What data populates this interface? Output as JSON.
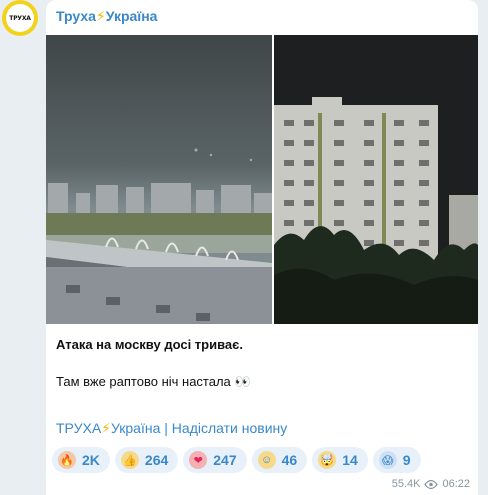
{
  "channel": {
    "avatar_label": "ТРУХА",
    "name": "Труха",
    "name_suffix": "Україна"
  },
  "post": {
    "headline": "Атака на москву досі триває.",
    "body": "Там вже раптово ніч настала",
    "body_emoji": "👀"
  },
  "footer_links": {
    "channel_part1": "ТРУХА",
    "channel_part2": "Україна",
    "separator": "|",
    "submit": "Надіслати новину"
  },
  "reactions": [
    {
      "emoji": "🔥",
      "emoji_icon": "fire-icon",
      "count": "2K",
      "bg": "#f4c7a5"
    },
    {
      "emoji": "👍",
      "emoji_icon": "thumbs-up-icon",
      "count": "264",
      "bg": "#f6d98a"
    },
    {
      "emoji": "❤",
      "emoji_icon": "heart-icon",
      "count": "247",
      "bg": "#f5b1b1"
    },
    {
      "emoji": "☺",
      "emoji_icon": "relieved-face-icon",
      "count": "46",
      "bg": "#f6d98a"
    },
    {
      "emoji": "🤯",
      "emoji_icon": "mind-blown-icon",
      "count": "14",
      "bg": "#f6d98a"
    },
    {
      "emoji": "😱",
      "emoji_icon": "screaming-face-icon",
      "count": "9",
      "bg": "#cfe0f4"
    }
  ],
  "meta": {
    "views": "55.4K",
    "time": "06:22"
  },
  "colors": {
    "accent": "#3a88c9",
    "avatar_ring": "#f3d21c",
    "bolt": "#f5b800"
  }
}
